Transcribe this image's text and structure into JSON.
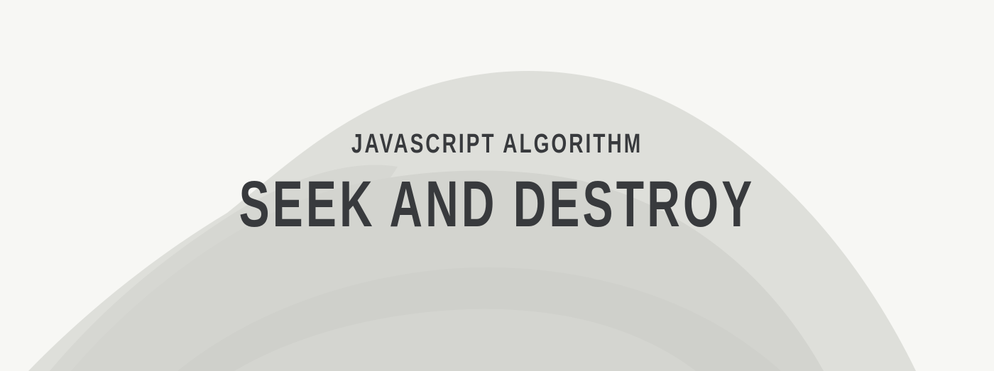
{
  "hero": {
    "kicker": "JAVASCRIPT ALGORITHM",
    "headline": "SEEK AND DESTROY"
  },
  "colors": {
    "background": "#f7f7f4",
    "text": "#383a3d",
    "blob_outer": "#dcddd8",
    "blob_inner": "#d2d3ce"
  }
}
